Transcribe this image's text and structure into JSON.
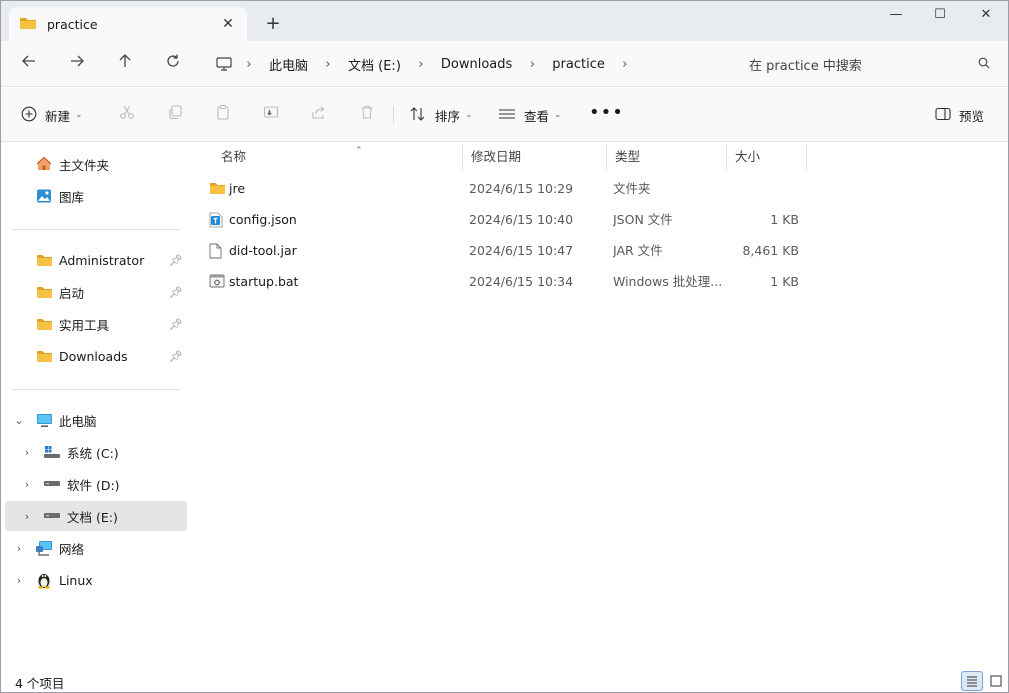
{
  "tab": {
    "title": "practice",
    "close": "✕",
    "new": "+"
  },
  "window_controls": {
    "minimize": "—",
    "maximize": "☐",
    "close": "✕"
  },
  "breadcrumb": [
    "此电脑",
    "文档 (E:)",
    "Downloads",
    "practice"
  ],
  "search": {
    "placeholder": "在 practice 中搜索"
  },
  "toolbar": {
    "new_label": "新建",
    "sort_label": "排序",
    "view_label": "查看",
    "more": "•••",
    "preview_label": "预览"
  },
  "sidebar": {
    "quick": [
      {
        "label": "主文件夹",
        "icon": "home-icon"
      },
      {
        "label": "图库",
        "icon": "gallery-icon"
      }
    ],
    "pinned": [
      {
        "label": "Administrator",
        "icon": "folder-icon",
        "pinned": true
      },
      {
        "label": "启动",
        "icon": "folder-icon",
        "pinned": true
      },
      {
        "label": "实用工具",
        "icon": "folder-icon",
        "pinned": true
      },
      {
        "label": "Downloads",
        "icon": "folder-icon",
        "pinned": true
      }
    ],
    "tree": [
      {
        "label": "此电脑",
        "icon": "computer-icon",
        "expanded": true
      },
      {
        "label": "系统 (C:)",
        "icon": "drive-icon",
        "expanded": false
      },
      {
        "label": "软件 (D:)",
        "icon": "drive-icon",
        "expanded": false
      },
      {
        "label": "文档 (E:)",
        "icon": "drive-icon",
        "expanded": false,
        "selected": true
      },
      {
        "label": "网络",
        "icon": "network-icon",
        "expanded": false
      },
      {
        "label": "Linux",
        "icon": "linux-icon",
        "expanded": false
      }
    ]
  },
  "columns": {
    "name": "名称",
    "date": "修改日期",
    "type": "类型",
    "size": "大小"
  },
  "files": [
    {
      "name": "jre",
      "date": "2024/6/15 10:29",
      "type": "文件夹",
      "size": "",
      "icon": "folder-icon"
    },
    {
      "name": "config.json",
      "date": "2024/6/15 10:40",
      "type": "JSON 文件",
      "size": "1 KB",
      "icon": "json-file-icon"
    },
    {
      "name": "did-tool.jar",
      "date": "2024/6/15 10:47",
      "type": "JAR 文件",
      "size": "8,461 KB",
      "icon": "file-icon"
    },
    {
      "name": "startup.bat",
      "date": "2024/6/15 10:34",
      "type": "Windows 批处理...",
      "size": "1 KB",
      "icon": "batch-file-icon"
    }
  ],
  "status": {
    "item_count": "4 个项目"
  },
  "colors": {
    "folder": "#f5c242",
    "folder_dark": "#e0a526",
    "selection": "#e5e5e5",
    "accent": "#0067c0"
  }
}
